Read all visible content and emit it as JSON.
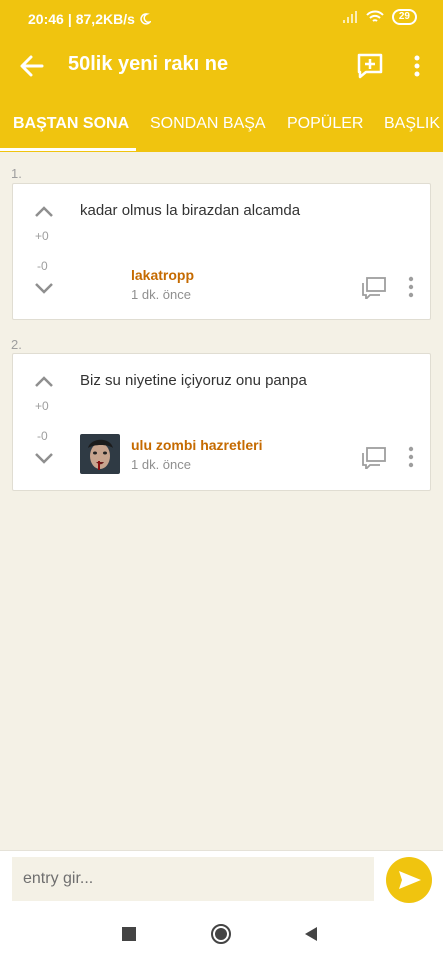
{
  "statusbar": {
    "time": "20:46",
    "speed": "87,2KB/s",
    "battery": "29"
  },
  "appbar": {
    "title": "50lik yeni rakı ne"
  },
  "tabs": [
    {
      "label": "BAŞTAN SONA",
      "active": true
    },
    {
      "label": "SONDAN BAŞA",
      "active": false
    },
    {
      "label": "POPÜLER",
      "active": false
    },
    {
      "label": "BAŞLIK",
      "active": false
    }
  ],
  "entries": [
    {
      "number": "1.",
      "text": "kadar olmus la birazdan alcamda",
      "upvotes": "+0",
      "downvotes": "-0",
      "author": "lakatropp",
      "time": "1 dk. önce",
      "has_avatar": false
    },
    {
      "number": "2.",
      "text": "Biz su niyetine içiyoruz onu panpa",
      "upvotes": "+0",
      "downvotes": "-0",
      "author": "ulu zombi hazretleri",
      "time": "1 dk. önce",
      "has_avatar": true
    }
  ],
  "composer": {
    "placeholder": "entry gir..."
  },
  "colors": {
    "accent": "#f0c40f",
    "author": "#c56a00",
    "background": "#f4f1e6"
  },
  "icons": {
    "back": "arrow-left-icon",
    "add": "add-entry-icon",
    "more": "more-vert-icon",
    "upvote": "chevron-up-icon",
    "downvote": "chevron-down-icon",
    "comment": "message-icon",
    "send": "send-icon"
  }
}
